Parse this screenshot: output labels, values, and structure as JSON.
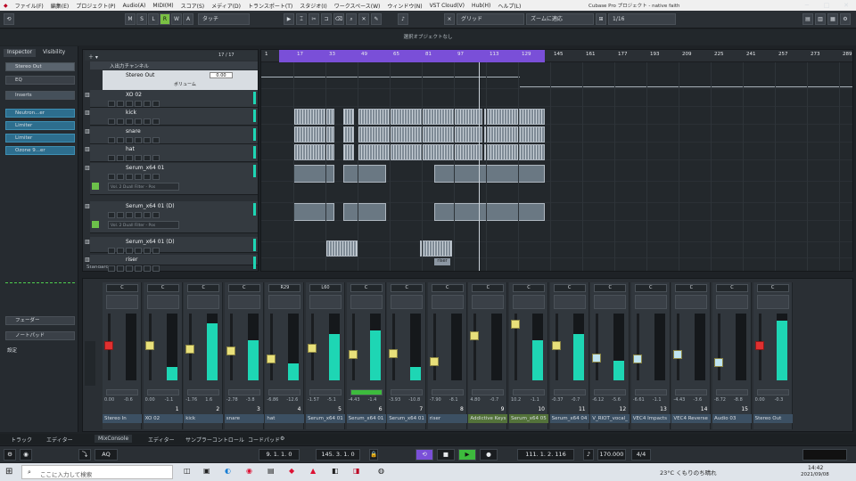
{
  "menubar": {
    "items": [
      "ファイル(F)",
      "編集(E)",
      "プロジェクト(P)",
      "Audio(A)",
      "MIDI(M)",
      "スコア(S)",
      "メディア(D)",
      "トランスポート(T)",
      "スタジオ(I)",
      "ワークスペース(W)",
      "ウィンドウ(N)",
      "VST Cloud(V)",
      "Hub(H)",
      "ヘルプ(L)"
    ],
    "window_title": "Cubase Pro プロジェクト - native faith"
  },
  "toolbar": {
    "mode_buttons": [
      "M",
      "S",
      "L",
      "R",
      "W",
      "A"
    ],
    "automation_mode": "タッチ",
    "snap_mode": "グリッド",
    "zoom_mode": "ズームに適応",
    "quantize": "1/16"
  },
  "info_line": "選択オブジェクトなし",
  "inspector": {
    "tabs": [
      "Inspector",
      "Visibility"
    ],
    "channel": "Stereo Out",
    "sections": [
      "EQ",
      "Inserts"
    ],
    "inserts": [
      "Neutron...er",
      "Limiter",
      "Limiter",
      "Ozone 9...er"
    ],
    "bottom_sections": [
      "フェーダー",
      "ノートパッド"
    ],
    "settings_label": "設定"
  },
  "tracklist": {
    "header_count": "17 / 17",
    "io_folder": "入出力チャンネル",
    "stereo_out": "Stereo Out",
    "stereo_out_value": "0.00",
    "volume_label": "ボリューム",
    "tracks": [
      "XO 02",
      "kick",
      "snare",
      "hat",
      "Serum_x64 01",
      "Serum_x64 01 (D)",
      "Serum_x64 01 (D)",
      "riser"
    ],
    "automation_lane_label": "Vol. 2 Duall Filter - Pos",
    "footer": "Standard"
  },
  "ruler": {
    "bars": [
      "1",
      "17",
      "33",
      "49",
      "65",
      "81",
      "97",
      "113",
      "129",
      "145",
      "161",
      "177",
      "193",
      "209",
      "225",
      "241",
      "257",
      "273",
      "289"
    ]
  },
  "riser_label": "riser",
  "mixer": {
    "channels": [
      {
        "name": "Stereo In",
        "idx": "",
        "pan": "C",
        "vol": "0.00",
        "peak": "-0.6",
        "level": 0.0
      },
      {
        "name": "XO 02",
        "idx": "1",
        "pan": "C",
        "vol": "0.00",
        "peak": "-1.1",
        "level": 0.2
      },
      {
        "name": "kick",
        "idx": "2",
        "pan": "C",
        "vol": "-1.76",
        "peak": "1.6",
        "level": 0.85
      },
      {
        "name": "snare",
        "idx": "3",
        "pan": "C",
        "vol": "-2.78",
        "peak": "-3.8",
        "level": 0.6
      },
      {
        "name": "hat",
        "idx": "4",
        "pan": "R29",
        "vol": "-6.86",
        "peak": "-12.6",
        "level": 0.25
      },
      {
        "name": "Serum_x64 01",
        "idx": "5",
        "pan": "L60",
        "vol": "-1.57",
        "peak": "-5.1",
        "level": 0.7
      },
      {
        "name": "Serum_x64 01",
        "idx": "6",
        "pan": "C",
        "vol": "-4.43",
        "peak": "-1.4",
        "level": 0.75
      },
      {
        "name": "Serum_x64 01",
        "idx": "7",
        "pan": "C",
        "vol": "-3.93",
        "peak": "-10.8",
        "level": 0.2
      },
      {
        "name": "riser",
        "idx": "8",
        "pan": "C",
        "vol": "-7.90",
        "peak": "-8.1",
        "level": 0.0
      },
      {
        "name": "Addictive Keys",
        "idx": "9",
        "pan": "C",
        "vol": "4.80",
        "peak": "-0.7",
        "level": 0.0
      },
      {
        "name": "Serum_x64 05",
        "idx": "10",
        "pan": "C",
        "vol": "10.2",
        "peak": "-1.1",
        "level": 0.6
      },
      {
        "name": "Serum_x64 04",
        "idx": "11",
        "pan": "C",
        "vol": "-0.37",
        "peak": "-0.7",
        "level": 0.7
      },
      {
        "name": "V_RIOT_vocal_",
        "idx": "12",
        "pan": "C",
        "vol": "-6.12",
        "peak": "-5.6",
        "level": 0.3
      },
      {
        "name": "VEC4 Impacts",
        "idx": "13",
        "pan": "C",
        "vol": "-6.61",
        "peak": "-1.1",
        "level": 0.0
      },
      {
        "name": "VEC4 Reverse",
        "idx": "14",
        "pan": "C",
        "vol": "-4.43",
        "peak": "-3.6",
        "level": 0.0
      },
      {
        "name": "Audio 03",
        "idx": "15",
        "pan": "C",
        "vol": "-8.72",
        "peak": "-8.8",
        "level": 0.0
      },
      {
        "name": "Stereo Out",
        "idx": "",
        "pan": "C",
        "vol": "0.00",
        "peak": "-0.3",
        "level": 0.9
      }
    ]
  },
  "bottom_tabs": [
    "トラック",
    "エディター",
    "MixConsole",
    "エディター",
    "サンプラーコントロール",
    "コードパッド"
  ],
  "transport": {
    "left_locator": "9. 1. 1. 0",
    "right_locator": "145. 3. 1. 0",
    "position": "111. 1. 2. 116",
    "tempo": "170.000",
    "signature": "4/4",
    "aq_label": "AQ"
  },
  "taskbar": {
    "search_placeholder": "ここに入力して検索",
    "weather": "23°C くもりのち晴れ",
    "time": "14:42",
    "date": "2021/09/08"
  },
  "colors": {
    "cycle": "#7a4fd8",
    "meter": "#1ed6b4",
    "fader_cap": "#e8e07a",
    "record": "#e03030",
    "play": "#3dbb3d"
  }
}
